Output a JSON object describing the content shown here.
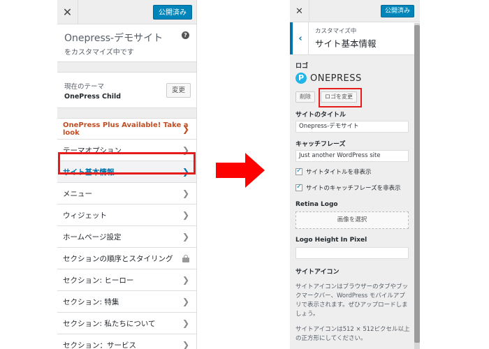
{
  "left": {
    "close_icon": "✕",
    "publish_label": "公開済み",
    "site_title": "Onepress-デモサイト",
    "site_subtitle": "をカスタマイズ中です",
    "help_icon": "?",
    "theme_label": "現在のテーマ",
    "theme_name": "OnePress Child",
    "change_label": "変更",
    "promo": "OnePress Plus Available! Take a look",
    "menu": [
      "テーマオプション",
      "サイト基本情報",
      "メニュー",
      "ウィジェット",
      "ホームページ設定",
      "セクションの順序とスタイリング",
      "セクション: ヒーロー",
      "セクション: 特集",
      "セクション: 私たちについて",
      "セクション：サービス"
    ]
  },
  "right": {
    "close_icon": "✕",
    "publish_label": "公開済み",
    "back_icon": "‹",
    "breadcrumb": "カスタマイズ中",
    "section_title": "サイト基本情報",
    "logo_label": "ロゴ",
    "logo_mark": "P",
    "logo_text": "ONEPRESS",
    "remove_label": "削除",
    "change_logo_label": "ロゴを変更",
    "site_title_label": "サイトのタイトル",
    "site_title_value": "Onepress-デモサイト",
    "tagline_label": "キャッチフレーズ",
    "tagline_value": "Just another WordPress site",
    "hide_title_label": "サイトタイトルを非表示",
    "hide_tagline_label": "サイトのキャッチフレーズを非表示",
    "retina_label": "Retina Logo",
    "select_image_label": "画像を選択",
    "logo_height_label": "Logo Height In Pixel",
    "site_icon_label": "サイトアイコン",
    "site_icon_desc": "サイトアイコンはブラウザーのタブやブックマークバー、WordPress モバイルアプリで表示されます。ぜひアップロードしましょう。",
    "site_icon_size": "サイトアイコンは512 × 512ピクセル以上の正方形にしてください。"
  },
  "colors": {
    "publish_blue": "#0085ba",
    "active_blue": "#0073aa",
    "promo_orange": "#c14d23",
    "highlight_red": "#e41c1c",
    "arrow_red": "#ff0000"
  }
}
